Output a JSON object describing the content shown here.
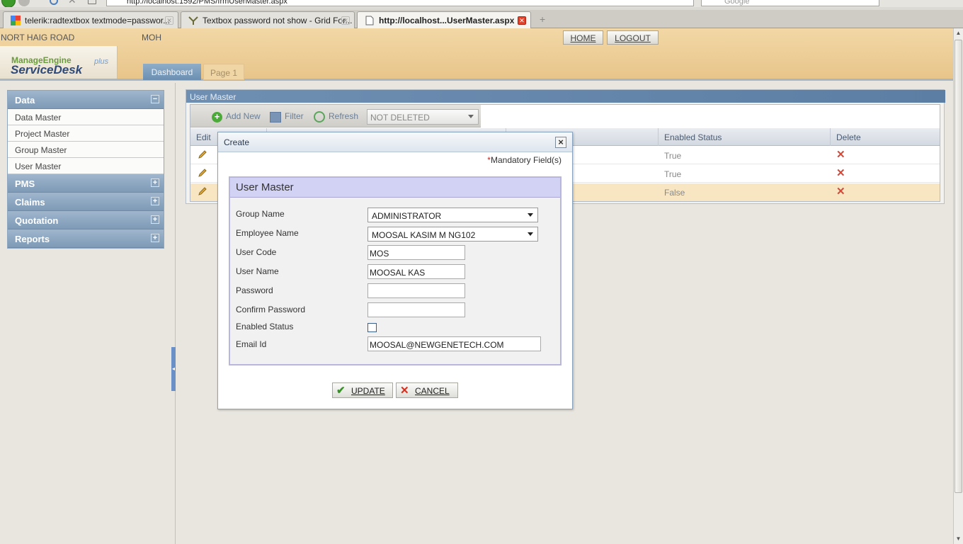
{
  "browser": {
    "url": "http://localhost:1592/PMS/frmUserMaster.aspx",
    "search_placeholder": "Google",
    "tabs": [
      {
        "label": "telerik:radtextbox textmode=passwor..."
      },
      {
        "label": "Textbox password not show - Grid For..."
      },
      {
        "label": "http://localhost...UserMaster.aspx"
      }
    ],
    "new_tab": "+"
  },
  "header": {
    "location": "NORT HAIG ROAD",
    "user": "MOH",
    "logo_top": "ManageEngine",
    "logo_main": "ServiceDesk",
    "logo_plus": "plus",
    "home_label": "HOME",
    "logout_label": "LOGOUT",
    "tabs": [
      {
        "label": "Dashboard"
      },
      {
        "label": "Page 1"
      }
    ]
  },
  "sidebar": {
    "sections": [
      {
        "label": "Data",
        "toggle": "−",
        "items": [
          {
            "label": "Data Master"
          },
          {
            "label": "Project Master"
          },
          {
            "label": "Group Master"
          },
          {
            "label": "User Master"
          }
        ]
      },
      {
        "label": "PMS",
        "toggle": "+"
      },
      {
        "label": "Claims",
        "toggle": "+"
      },
      {
        "label": "Quotation",
        "toggle": "+"
      },
      {
        "label": "Reports",
        "toggle": "+"
      }
    ]
  },
  "panel": {
    "title": "User Master",
    "toolbar": {
      "add_new": "Add New",
      "filter": "Filter",
      "refresh": "Refresh",
      "status_filter": "NOT DELETED"
    },
    "columns": {
      "edit": "Edit",
      "enabled": "Enabled Status",
      "delete": "Delete"
    },
    "rows": [
      {
        "enabled": "True"
      },
      {
        "enabled": "True"
      },
      {
        "enabled": "False"
      }
    ]
  },
  "modal": {
    "title": "Create",
    "mandatory_star": "*",
    "mandatory_text": "Mandatory Field(s)",
    "legend": "User Master",
    "fields": {
      "group_name": {
        "label": "Group Name",
        "value": "ADMINISTRATOR"
      },
      "employee_name": {
        "label": "Employee Name",
        "value": "MOOSAL KASIM M NG102"
      },
      "user_code": {
        "label": "User Code",
        "value": "MOS"
      },
      "user_name": {
        "label": "User Name",
        "value": "MOOSAL KAS"
      },
      "password": {
        "label": "Password",
        "value": ""
      },
      "confirm_password": {
        "label": "Confirm Password",
        "value": ""
      },
      "enabled_status": {
        "label": "Enabled Status",
        "checked": false
      },
      "email": {
        "label": "Email Id",
        "value": "MOOSAL@NEWGENETECH.COM"
      }
    },
    "update_label": "UPDATE",
    "cancel_label": "CANCEL"
  },
  "colors": {
    "accent": "#7e9ab6",
    "header_bg": "#e8c58a",
    "selected_row": "#f8e6c3",
    "delete": "#d24a3a"
  },
  "icons": {
    "back": "back-icon",
    "reload": "reload-icon",
    "add": "plus-circle-icon",
    "filter": "filter-icon",
    "refresh": "refresh-icon",
    "edit": "pencil-icon",
    "delete": "x-icon",
    "update": "checkmark-icon",
    "cancel": "x-icon"
  }
}
